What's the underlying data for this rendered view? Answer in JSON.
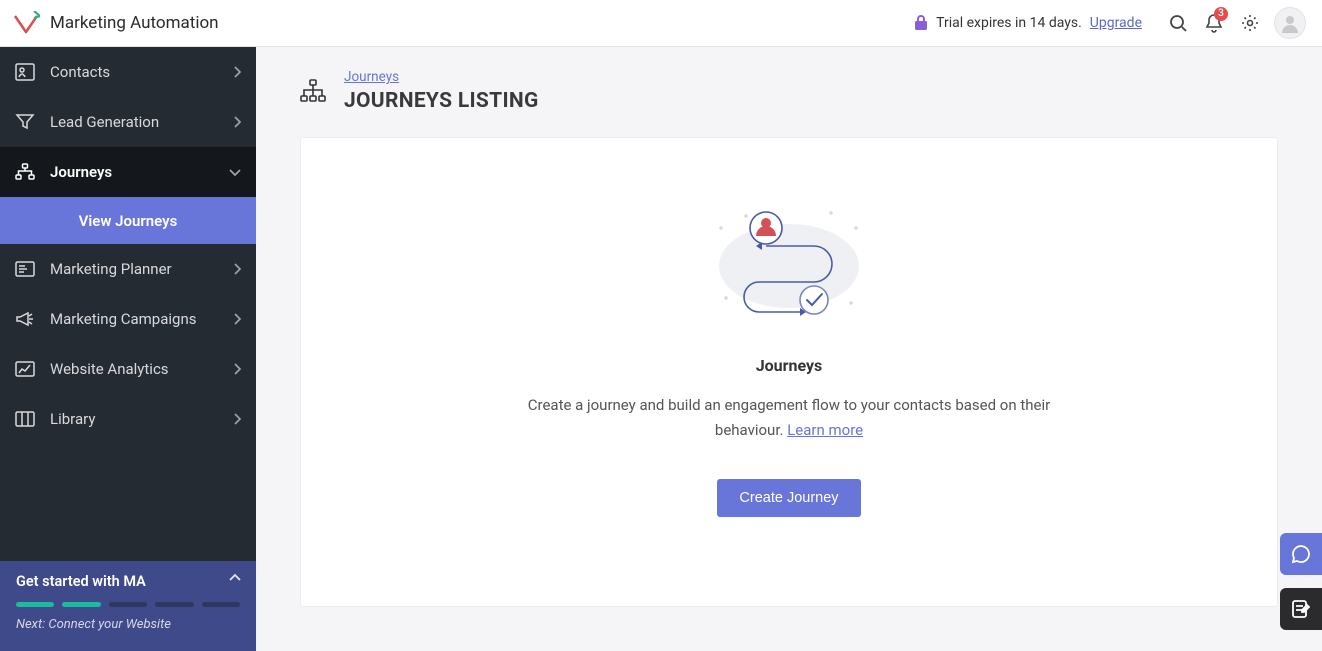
{
  "header": {
    "app_title": "Marketing Automation",
    "trial_text": "Trial expires in 14 days.",
    "upgrade_label": "Upgrade",
    "notification_count": "3"
  },
  "sidebar": {
    "items": [
      {
        "label": "Contacts"
      },
      {
        "label": "Lead Generation"
      },
      {
        "label": "Journeys"
      },
      {
        "label": "Marketing Planner"
      },
      {
        "label": "Marketing Campaigns"
      },
      {
        "label": "Website Analytics"
      },
      {
        "label": "Library"
      }
    ],
    "journeys_sub": {
      "label": "View Journeys"
    },
    "get_started": {
      "title": "Get started with MA",
      "next": "Next: Connect your Website",
      "steps_total": 5,
      "steps_done": 2
    }
  },
  "page": {
    "breadcrumb": "Journeys",
    "title": "JOURNEYS LISTING",
    "empty_title": "Journeys",
    "empty_desc": "Create a journey and build an engagement flow to your contacts based on their behaviour. ",
    "learn_more": "Learn more",
    "create_button": "Create Journey"
  },
  "colors": {
    "accent": "#6776d8",
    "sidebar_bg": "#252b33"
  }
}
